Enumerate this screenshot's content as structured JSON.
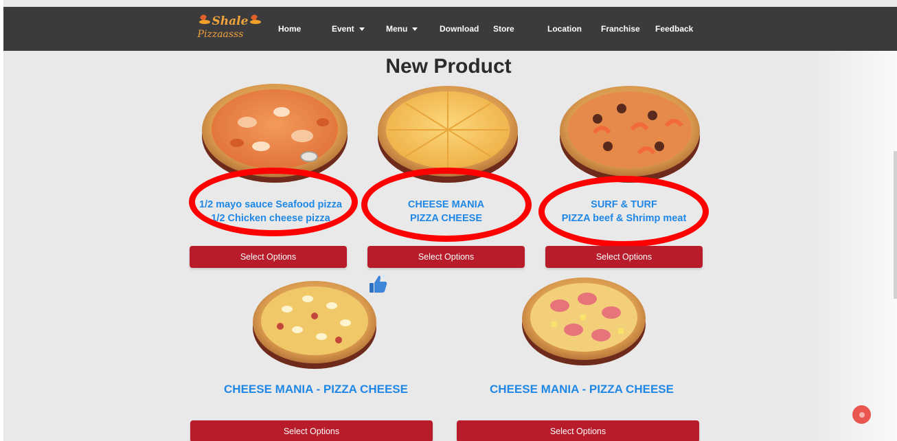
{
  "brand": {
    "line1": "Shale",
    "line2": "Pizzaasss"
  },
  "nav": {
    "home": "Home",
    "event": "Event",
    "menu": "Menu",
    "download": "Download",
    "store": "Store",
    "location": "Location",
    "franchise": "Franchise",
    "feedback": "Feedback"
  },
  "heading": "New Product",
  "products": [
    {
      "line1": "1/2 mayo sauce Seafood pizza",
      "line2": "1/2 Chicken cheese pizza",
      "button": "Select Options"
    },
    {
      "line1": "CHEESE MANIA",
      "line2": "PIZZA CHEESE",
      "button": "Select Options"
    },
    {
      "line1": "SURF & TURF",
      "line2": "PIZZA beef & Shrimp meat",
      "button": "Select Options"
    },
    {
      "title": "CHEESE MANIA - PIZZA CHEESE",
      "button": "Select Options"
    },
    {
      "title": "CHEESE MANIA - PIZZA CHEESE",
      "button": "Select Options"
    }
  ],
  "colors": {
    "navbar": "#3b3a3d",
    "button": "#b81b2a",
    "title_link": "#1f87e6",
    "annotation_ring": "#ff0000"
  },
  "icons": {
    "thumbs_up": "thumbs-up-icon",
    "floating": "floating-action-icon"
  }
}
